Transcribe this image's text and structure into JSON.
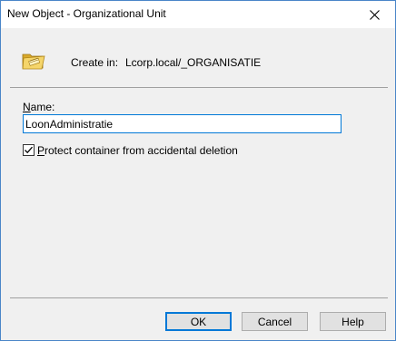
{
  "window": {
    "title": "New Object - Organizational Unit"
  },
  "header": {
    "create_in_label": "Create in:",
    "create_in_value": "Lcorp.local/_ORGANISATIE"
  },
  "form": {
    "name_label_mnemonic": "N",
    "name_label_rest": "ame:",
    "name_value": "LoonAdministratie",
    "protect_checked": true,
    "protect_label_mnemonic": "P",
    "protect_label_rest": "rotect container from accidental deletion"
  },
  "buttons": {
    "ok": "OK",
    "cancel": "Cancel",
    "help": "Help"
  },
  "icons": {
    "folder": "ou-folder-icon",
    "close": "close-icon",
    "check": "checkmark-icon"
  },
  "colors": {
    "accent": "#0078d7",
    "window_border": "#4a86c8",
    "dialog_bg": "#f0f0f0",
    "button_bg": "#e1e1e1"
  }
}
